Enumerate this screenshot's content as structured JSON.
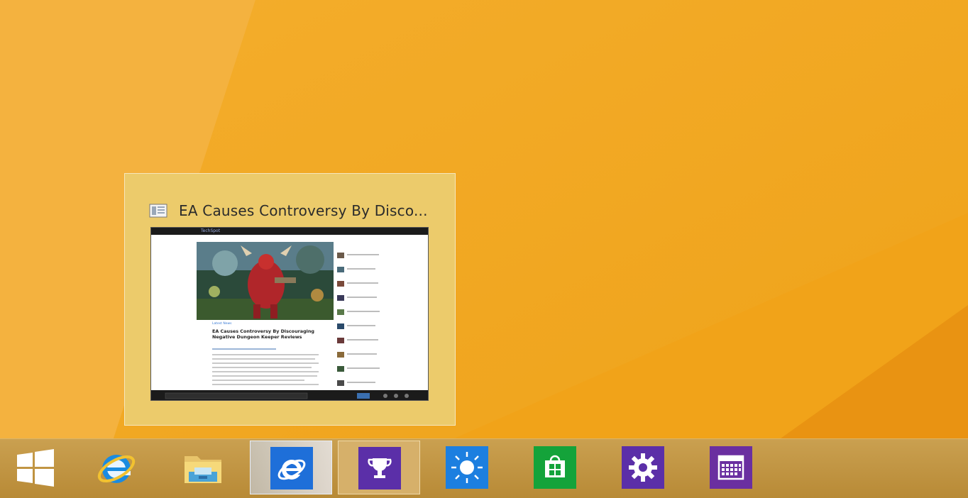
{
  "desktop": {
    "background_color": "#f0a018"
  },
  "preview": {
    "title": "EA Causes Controversy By Disco...",
    "page_icon": "webpage-icon",
    "thumbnail": {
      "brand": "TechSpot",
      "category": "Latest News",
      "headline": "EA Causes Controversy By Discouraging Negative Dungeon Keeper Reviews"
    }
  },
  "taskbar": {
    "items": [
      {
        "name": "start-button",
        "icon": "windows-logo-icon",
        "state": "normal"
      },
      {
        "name": "internet-explorer-pinned",
        "icon": "internet-explorer-icon",
        "state": "normal"
      },
      {
        "name": "file-explorer-pinned",
        "icon": "folder-icon",
        "state": "normal"
      },
      {
        "name": "internet-explorer-modern",
        "icon": "internet-explorer-tile-icon",
        "state": "active",
        "tile_color": "#1e6fd9"
      },
      {
        "name": "games-app",
        "icon": "trophy-icon",
        "state": "hover",
        "tile_color": "#5b2fa8"
      },
      {
        "name": "weather-app",
        "icon": "sun-icon",
        "state": "normal",
        "tile_color": "#1c7fe0"
      },
      {
        "name": "store-app",
        "icon": "store-bag-icon",
        "state": "normal",
        "tile_color": "#14a33a"
      },
      {
        "name": "pc-settings-app",
        "icon": "gear-icon",
        "state": "normal",
        "tile_color": "#5b2fa8"
      },
      {
        "name": "calendar-app",
        "icon": "calendar-icon",
        "state": "normal",
        "tile_color": "#6a2fa0"
      }
    ]
  }
}
